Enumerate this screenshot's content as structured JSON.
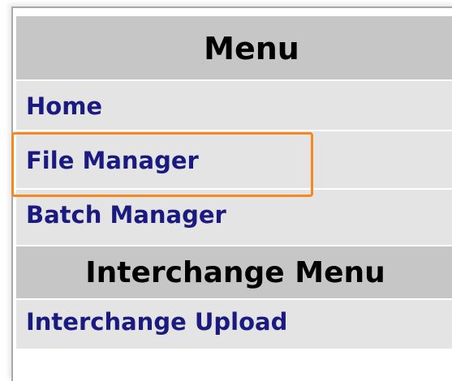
{
  "menu": {
    "title": "Menu",
    "items": [
      {
        "label": "Home"
      },
      {
        "label": "File Manager"
      },
      {
        "label": "Batch Manager"
      }
    ]
  },
  "interchange_menu": {
    "title": "Interchange Menu",
    "items": [
      {
        "label": "Interchange Upload"
      }
    ]
  },
  "colors": {
    "header_bg": "#c6c6c6",
    "item_bg": "#e4e4e4",
    "link_text": "#1a1a80",
    "highlight_border": "#f5891f"
  }
}
